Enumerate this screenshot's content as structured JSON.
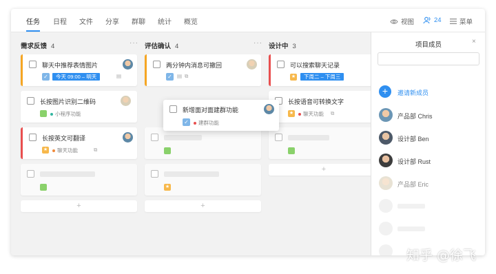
{
  "topbar": {
    "tabs": [
      "任务",
      "日程",
      "文件",
      "分享",
      "群聊",
      "统计",
      "概览"
    ],
    "view_label": "视图",
    "member_count": "24",
    "menu_label": "菜单"
  },
  "columns": [
    {
      "title": "需求反馈",
      "count": "4",
      "cards": [
        {
          "title": "聊天中推荐表情图片",
          "tag": "今天 09:00 – 明天"
        },
        {
          "title": "长按图片识别二维码",
          "meta": "小程序功能"
        },
        {
          "title": "长按英文可翻译",
          "meta": "聊天功能"
        }
      ]
    },
    {
      "title": "评估确认",
      "count": "4",
      "cards": [
        {
          "title": "两分钟内消息可撤回"
        }
      ]
    },
    {
      "title": "设计中",
      "count": "3",
      "cards": [
        {
          "title": "可以搜索聊天记录",
          "tag": "下周二 – 下周三"
        },
        {
          "title": "长按语音可转换文字",
          "meta": "聊天功能"
        }
      ]
    }
  ],
  "dragging_card": {
    "title": "新增面对面建群功能",
    "meta": "建群功能"
  },
  "add_symbol": "+",
  "panel": {
    "title": "项目成员",
    "close": "×",
    "search_value": "",
    "invite_label": "邀请新成员",
    "members": [
      "产品部 Chris",
      "设计部 Ben",
      "设计部 Rust",
      "产品部 Eric"
    ]
  },
  "watermark": "知乎 @徐飞",
  "colors": {
    "accent": "#2f8ff0",
    "orange": "#f5a623",
    "red": "#e94f4f",
    "green": "#8ad16b"
  }
}
